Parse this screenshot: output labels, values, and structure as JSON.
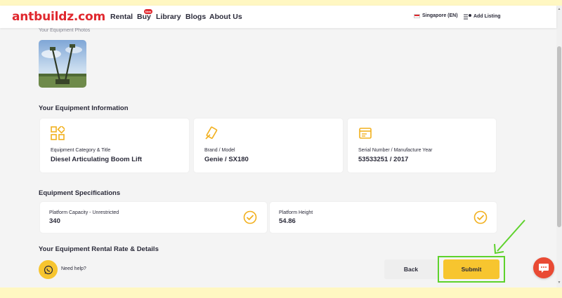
{
  "header": {
    "logo": "antbuildz.com",
    "nav": [
      {
        "label": "Rental"
      },
      {
        "label": "Buy"
      },
      {
        "label": "Library"
      },
      {
        "label": "Blogs"
      },
      {
        "label": "About Us"
      }
    ],
    "buy_badge": "New",
    "region": "Singapore (EN)",
    "add_listing": "Add Listing",
    "icons": [
      "mail-icon",
      "user-icon"
    ]
  },
  "photos": {
    "label": "Your Equipment Photos"
  },
  "equipment_info": {
    "title": "Your Equipment Information",
    "cards": [
      {
        "icon": "category-grid-icon",
        "label": "Equipment Category & Title",
        "value": "Diesel Articulating Boom Lift"
      },
      {
        "icon": "brand-tag-icon",
        "label": "Brand / Model",
        "value": "Genie / SX180"
      },
      {
        "icon": "serial-id-icon",
        "label": "Serial Number / Manufacture Year",
        "value": "53533251 / 2017"
      }
    ]
  },
  "specifications": {
    "title": "Equipment Specifications",
    "items": [
      {
        "label": "Platform Capacity - Unrestricted",
        "value": "340"
      },
      {
        "label": "Platform Height",
        "value": "54.86"
      }
    ]
  },
  "rental": {
    "title": "Your Equipment Rental Rate & Details"
  },
  "footer": {
    "help_text": "Need help?",
    "back_label": "Back",
    "submit_label": "Submit"
  },
  "colors": {
    "brand_red": "#e0282e",
    "accent_yellow": "#f7c52f",
    "highlight_green": "#5ed22c",
    "chat_red": "#e94a34"
  }
}
